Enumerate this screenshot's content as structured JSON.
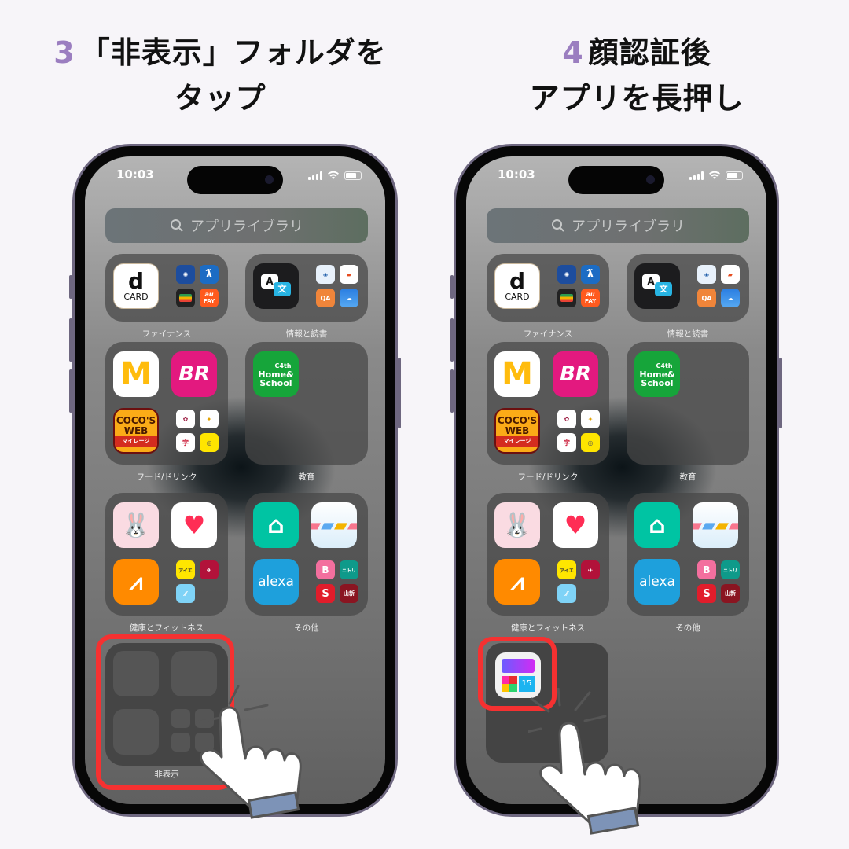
{
  "steps": [
    {
      "number": "3",
      "title_line1": "「非表示」フォルダを",
      "title_line2": "タップ"
    },
    {
      "number": "4",
      "title_line1": "顔認証後",
      "title_line2": "アプリを長押し"
    }
  ],
  "accent_color": "#9b7ec0",
  "highlight_color": "#f53131",
  "phone": {
    "status_time": "10:03",
    "search_placeholder": "アプリライブラリ",
    "folders": [
      {
        "label": "ファイナンス",
        "large_app": "d CARD",
        "small_apps": [
          "bank-icon",
          "R-app-icon",
          "wallet-icon",
          "au PAY"
        ]
      },
      {
        "label": "情報と読書",
        "large_app": "translate-icon",
        "small_apps": [
          "box-app-icon",
          "BookLive",
          "QA-app-icon",
          "weather-icon"
        ]
      },
      {
        "label": "フード/ドリンク",
        "large_apps": [
          "McDonald's",
          "BR"
        ],
        "large_app_3": "COCO'S WEB マイレージ",
        "small_apps": [
          "food-app-1",
          "food-app-2",
          "food-app-3",
          "food-app-4"
        ]
      },
      {
        "label": "教育",
        "large_app": "C4th Home&School"
      },
      {
        "label": "健康とフィットネス",
        "large_apps": [
          "rabbit-app-icon",
          "health-heart-icon"
        ],
        "large_app_3": "orange-fitness-icon",
        "small_apps": [
          "fitness-app-1",
          "fitness-app-2",
          "fitness-app-3"
        ]
      },
      {
        "label": "その他",
        "large_apps": [
          "home-app-icon",
          "snowman-app-icon"
        ],
        "large_app_3": "alexa",
        "small_apps": [
          "B",
          "ニトリ",
          "S",
          "山新"
        ]
      },
      {
        "label": "非表示"
      }
    ],
    "app_texts": {
      "dcard_d": "d",
      "dcard_card": "CARD",
      "aupay_au": "au",
      "aupay_pay": "PAY",
      "br": "BR",
      "cocos_1": "COCO'S",
      "cocos_2": "WEB",
      "cocos_3": "マイレージ",
      "c4th_1": "C4th",
      "c4th_2": "Home&",
      "c4th_3": "School",
      "alexa": "alexa",
      "nitori": "ニトリ",
      "yamashin": "山新",
      "s": "S",
      "b": "B",
      "hidden_app_badge": "15",
      "translate_a": "A",
      "translate_wen": "文"
    }
  }
}
